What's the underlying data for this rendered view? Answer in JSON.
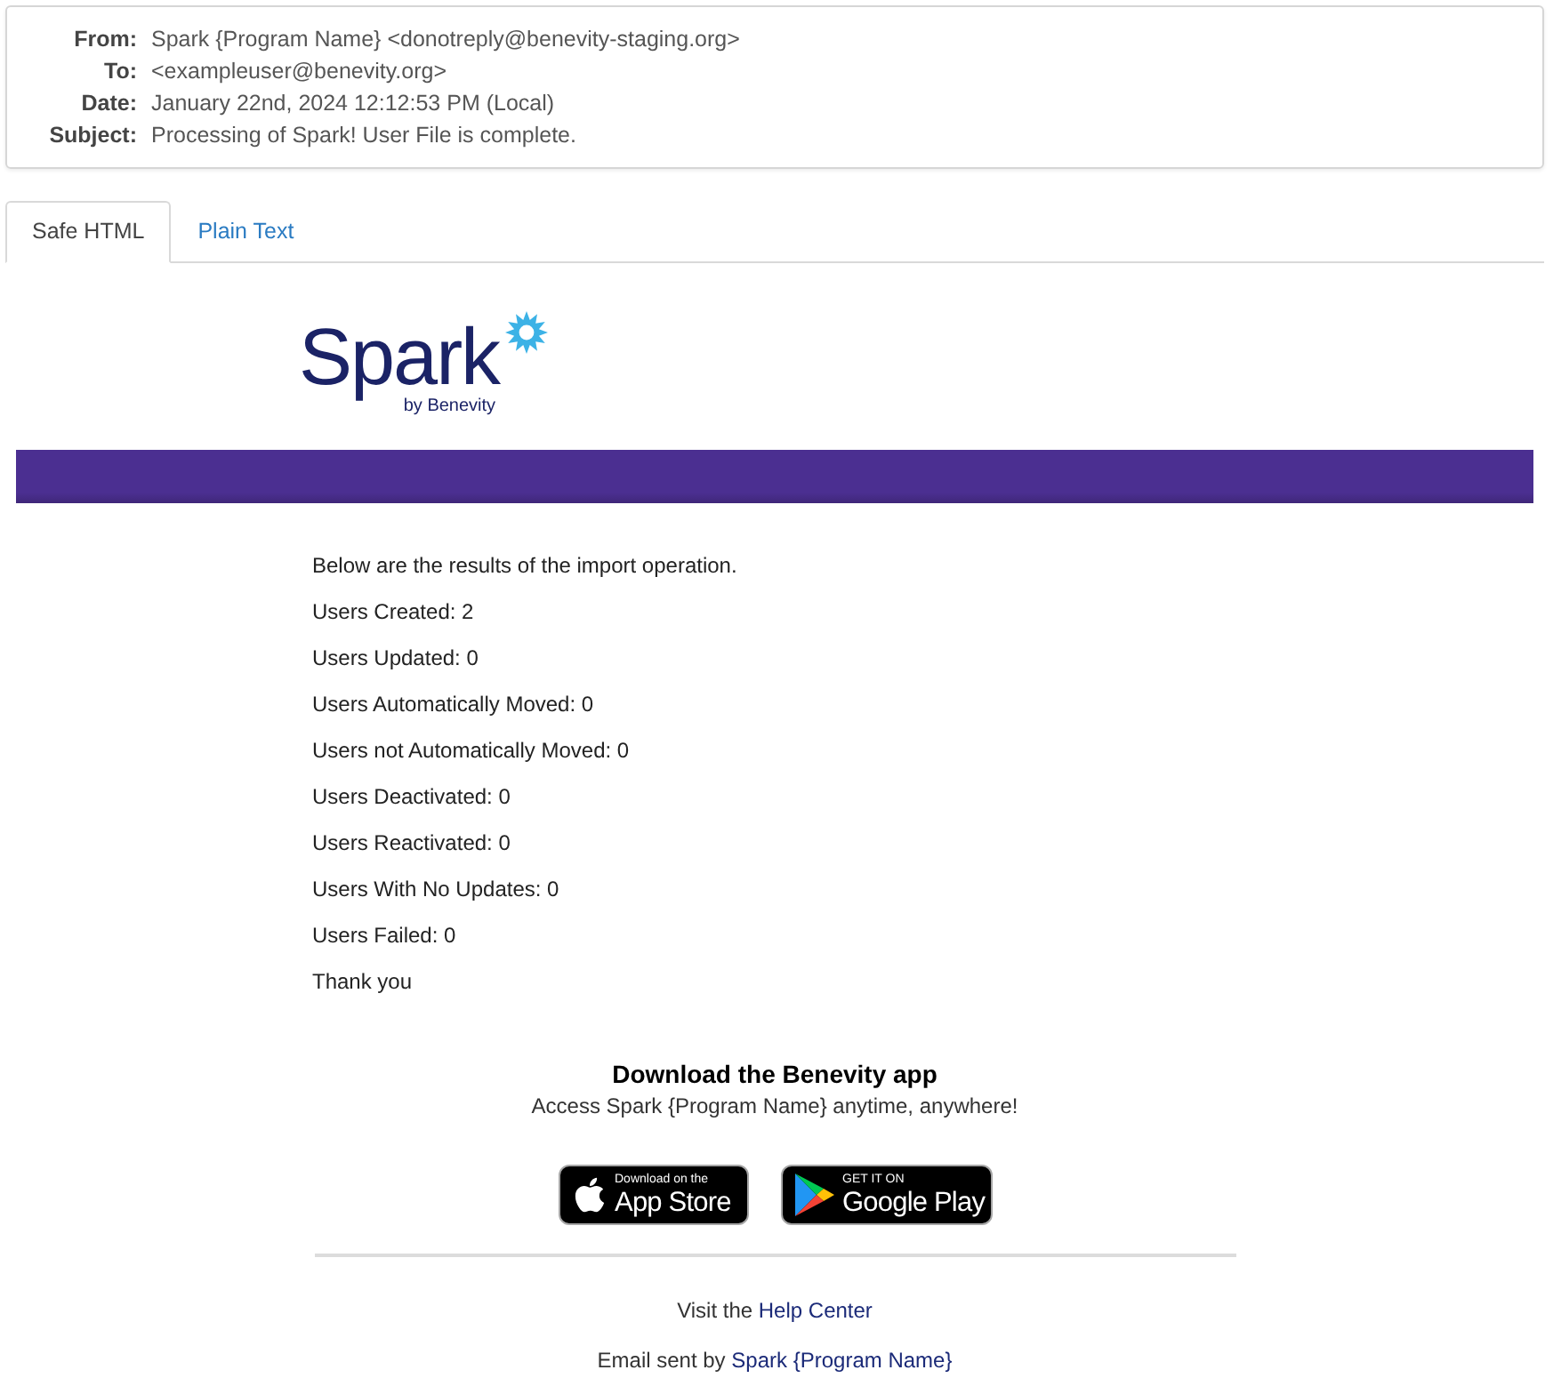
{
  "email_header": {
    "fields": [
      {
        "label": "From:",
        "value": "Spark {Program Name} <donotreply@benevity-staging.org>"
      },
      {
        "label": "To:",
        "value": "<exampleuser@benevity.org>"
      },
      {
        "label": "Date:",
        "value": "January 22nd, 2024 12:12:53 PM (Local)"
      },
      {
        "label": "Subject:",
        "value": "Processing of Spark! User File is complete."
      }
    ]
  },
  "tabs": [
    {
      "label": "Safe HTML",
      "selected": true
    },
    {
      "label": "Plain Text",
      "selected": false
    }
  ],
  "message": {
    "logo": {
      "wordmark": "Spark",
      "tagline": "by Benevity"
    },
    "lines": [
      "Below are the results of the import operation.",
      "Users Created: 2",
      "Users Updated: 0",
      "Users Automatically Moved: 0",
      "Users not Automatically Moved: 0",
      "Users Deactivated: 0",
      "Users Reactivated: 0",
      "Users With No Updates: 0",
      "Users Failed: 0",
      "Thank you"
    ],
    "app_promo": {
      "heading": "Download the Benevity app",
      "subheading": "Access Spark {Program Name} anytime, anywhere!",
      "badges": [
        {
          "kind": "app_store",
          "small_text": "Download on the",
          "large_text": "App Store"
        },
        {
          "kind": "google_play",
          "small_text": "GET IT ON",
          "large_text": "Google Play"
        }
      ]
    },
    "footer": [
      {
        "text": "Visit the",
        "link": "Help Center"
      },
      {
        "text": "Email sent by",
        "link": "Spark {Program Name}"
      }
    ]
  }
}
